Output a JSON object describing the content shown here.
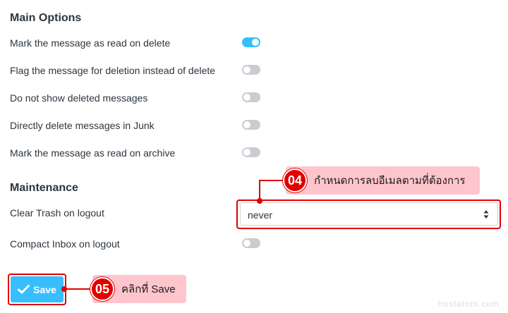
{
  "main_options": {
    "title": "Main Options",
    "items": [
      {
        "label": "Mark the message as read on delete",
        "enabled": true
      },
      {
        "label": "Flag the message for deletion instead of delete",
        "enabled": false
      },
      {
        "label": "Do not show deleted messages",
        "enabled": false
      },
      {
        "label": "Directly delete messages in Junk",
        "enabled": false
      },
      {
        "label": "Mark the message as read on archive",
        "enabled": false
      }
    ]
  },
  "maintenance": {
    "title": "Maintenance",
    "clear_trash_label": "Clear Trash on logout",
    "clear_trash_value": "never",
    "compact_inbox_label": "Compact Inbox on logout",
    "compact_inbox_enabled": false
  },
  "save_button": {
    "label": "Save",
    "icon": "checkmark-icon"
  },
  "callouts": [
    {
      "step": "04",
      "text": "กำหนดการลบอีเมลตามที่ต้องการ"
    },
    {
      "step": "05",
      "text": "คลิกที่ Save"
    }
  ],
  "watermark": "hostatom.com",
  "colors": {
    "accent": "#37beff",
    "toggle_off": "#c9ccd1",
    "callout_red": "#e00000",
    "callout_bg": "#ffc5cd"
  }
}
